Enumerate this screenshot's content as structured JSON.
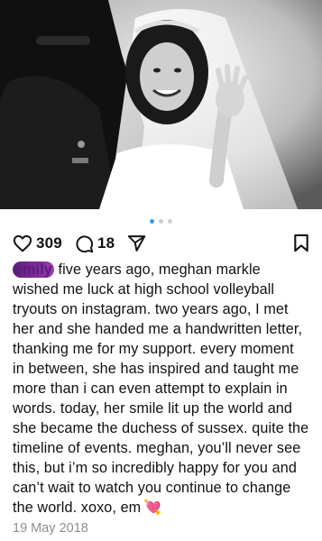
{
  "post": {
    "image": {
      "alt": "",
      "carousel_index": 1,
      "carousel_total": 3
    },
    "likes": "309",
    "comments": "18",
    "username": "emily",
    "username_suffix": " ",
    "caption": "five years ago, meghan markle wished me luck at high school volleyball tryouts on instagram. two years ago, I met her and she handed me a handwritten letter, thanking me for my support. every moment in between, she has inspired and taught me more than i can even attempt to explain in words. today, her smile lit up the world and she became the duchess of sussex. quite the timeline of events. meghan, you’ll never see this, but i’m so incredibly happy for you and can’t wait to watch you continue to change the world. xoxo, em",
    "caption_emoji": "💘",
    "date": "19 May 2018"
  },
  "icons": {
    "like": "heart-outline-icon",
    "comment": "comment-bubble-icon",
    "share": "paper-plane-icon",
    "save": "bookmark-icon"
  },
  "colors": {
    "carousel_active_dot": "#3897f0",
    "carousel_dot": "#cfcfcf",
    "username_scribble": "#7d2a99",
    "date_text": "#8e8e8e"
  }
}
